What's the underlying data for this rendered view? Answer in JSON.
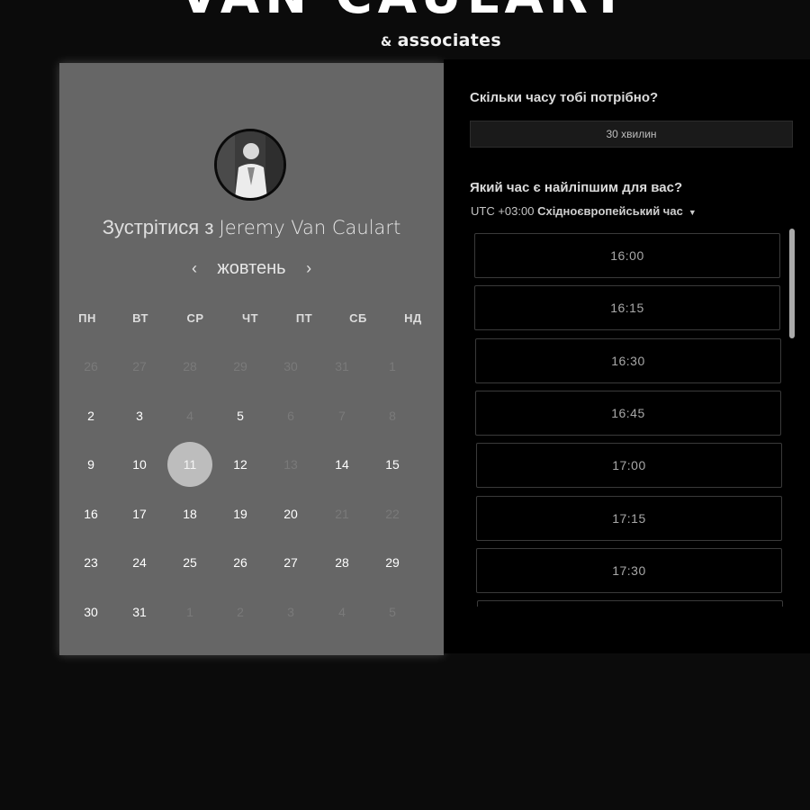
{
  "brand": {
    "name": "VAN CAULART",
    "amp": "&",
    "sub": "associates"
  },
  "calendar": {
    "meet_prefix": "Зустрітися з",
    "host_name": "Jeremy Van Caulart",
    "month": "жовтень",
    "prev_icon": "‹",
    "next_icon": "›",
    "weekdays": [
      "ПН",
      "ВТ",
      "СР",
      "ЧТ",
      "ПТ",
      "СБ",
      "НД"
    ],
    "weeks": [
      [
        "26",
        "27",
        "28",
        "29",
        "30",
        "31",
        "1"
      ],
      [
        "2",
        "3",
        "4",
        "5",
        "6",
        "7",
        "8"
      ],
      [
        "9",
        "10",
        "11",
        "12",
        "13",
        "14",
        "15"
      ],
      [
        "16",
        "17",
        "18",
        "19",
        "20",
        "21",
        "22"
      ],
      [
        "23",
        "24",
        "25",
        "26",
        "27",
        "28",
        "29"
      ],
      [
        "30",
        "31",
        "1",
        "2",
        "3",
        "4",
        "5"
      ]
    ],
    "selected_day": "11"
  },
  "booking": {
    "duration_question": "Скільки часу тобі потрібно?",
    "duration_value": "30 хвилин",
    "time_question": "Який час є найліпшим для вас?",
    "timezone_offset": "UTC +03:00",
    "timezone_name": "Східноєвропейський час",
    "caret_icon": "▼",
    "slots": [
      "16:00",
      "16:15",
      "16:30",
      "16:45",
      "17:00",
      "17:15",
      "17:30",
      ""
    ]
  },
  "colors": {
    "left_panel": "#666666",
    "right_panel": "#000000",
    "page": "#0b0b0b",
    "selected_day": "#bdbdbd"
  }
}
